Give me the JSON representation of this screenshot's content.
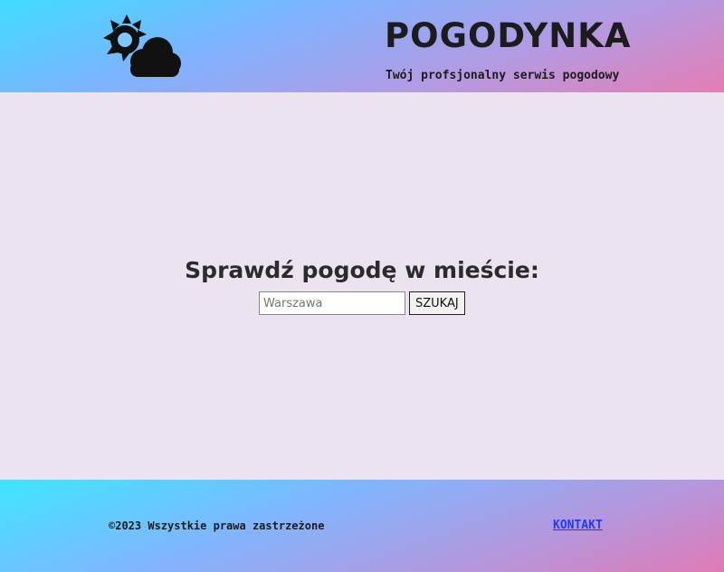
{
  "header": {
    "title": "POGODYNKA",
    "subtitle": "Twój profsjonalny serwis pogodowy",
    "logo_icon": "sun-cloud-icon"
  },
  "main": {
    "heading": "Sprawdź pogodę w mieście:",
    "search": {
      "placeholder": "Warszawa",
      "value": "",
      "button_label": "SZUKAJ"
    }
  },
  "footer": {
    "copyright": "©2023 Wszystkie prawa zastrzeżone",
    "contact_label": "KONTAKT"
  },
  "colors": {
    "page_background": "#ebe3f0",
    "gradient_start": "#3fdcff",
    "gradient_end": "#e57db3",
    "link": "#1f3cf0"
  }
}
